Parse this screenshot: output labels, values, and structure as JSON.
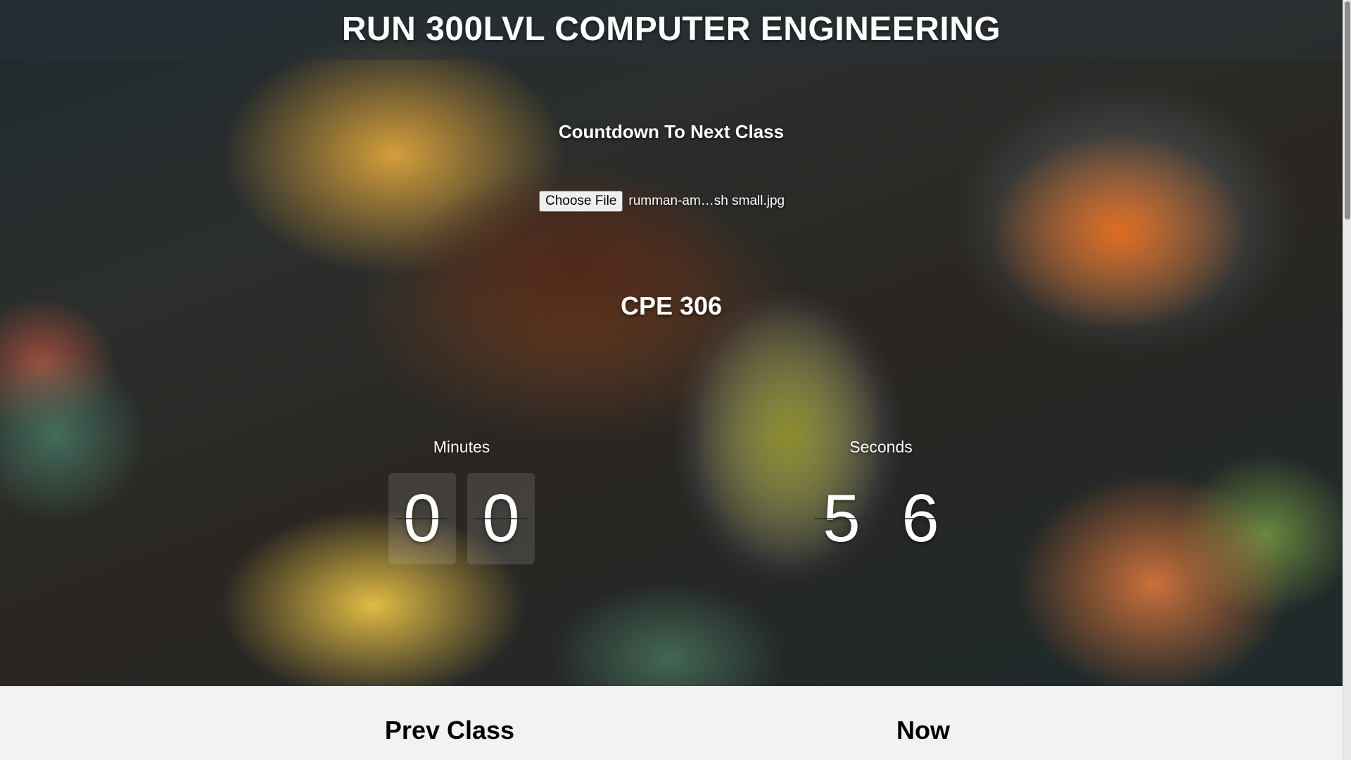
{
  "header": {
    "title": "RUN 300LVL COMPUTER ENGINEERING"
  },
  "countdown": {
    "heading": "Countdown To Next Class",
    "course_code": "CPE 306",
    "minutes_label": "Minutes",
    "seconds_label": "Seconds",
    "minutes_digits": [
      "0",
      "0"
    ],
    "seconds_digits": [
      "5",
      "6"
    ]
  },
  "file_input": {
    "button_label": "Choose File",
    "file_name": "rumman-am…sh small.jpg"
  },
  "schedule": {
    "prev_class_heading": "Prev Class",
    "now_heading": "Now"
  },
  "colors": {
    "title_text": "#ffffff",
    "bottom_background": "#f2f2f2"
  }
}
